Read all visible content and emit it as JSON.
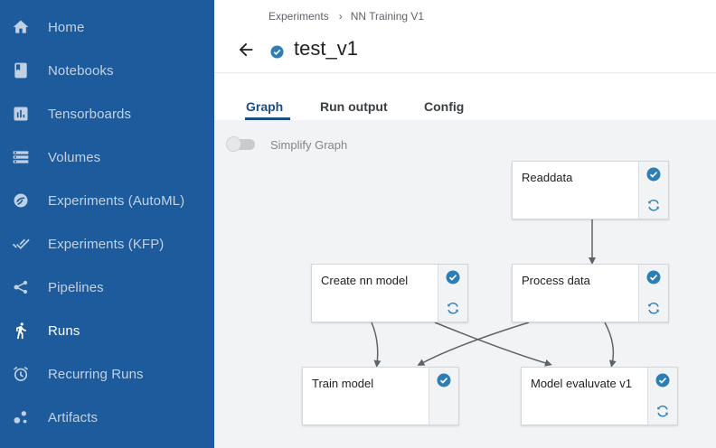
{
  "sidebar": {
    "items": [
      {
        "label": "Home",
        "icon": "home-icon"
      },
      {
        "label": "Notebooks",
        "icon": "notebook-icon"
      },
      {
        "label": "Tensorboards",
        "icon": "tensorboard-icon"
      },
      {
        "label": "Volumes",
        "icon": "volumes-icon"
      },
      {
        "label": "Experiments (AutoML)",
        "icon": "automl-icon"
      },
      {
        "label": "Experiments (KFP)",
        "icon": "double-check-icon"
      },
      {
        "label": "Pipelines",
        "icon": "pipeline-icon"
      },
      {
        "label": "Runs",
        "icon": "runner-icon"
      },
      {
        "label": "Recurring Runs",
        "icon": "alarm-icon"
      },
      {
        "label": "Artifacts",
        "icon": "artifacts-icon"
      }
    ],
    "active": "Runs"
  },
  "breadcrumb": {
    "items": [
      "Experiments",
      "NN Training V1"
    ],
    "separator": "›"
  },
  "header": {
    "title": "test_v1",
    "status": "succeeded"
  },
  "tabs": [
    {
      "label": "Graph",
      "active": true
    },
    {
      "label": "Run output",
      "active": false
    },
    {
      "label": "Config",
      "active": false
    }
  ],
  "graph": {
    "simplify_label": "Simplify Graph",
    "simplify_enabled": false,
    "nodes": [
      {
        "id": "readdata",
        "label": "Readdata",
        "status": "succeeded"
      },
      {
        "id": "create-nn-model",
        "label": "Create nn model",
        "status": "succeeded"
      },
      {
        "id": "process-data",
        "label": "Process data",
        "status": "succeeded"
      },
      {
        "id": "train-model",
        "label": "Train model",
        "status": "succeeded"
      },
      {
        "id": "model-evaluate",
        "label": "Model evaluvate v1",
        "status": "succeeded"
      }
    ],
    "edges": [
      [
        "readdata",
        "process-data"
      ],
      [
        "create-nn-model",
        "train-model"
      ],
      [
        "create-nn-model",
        "model-evaluate"
      ],
      [
        "process-data",
        "train-model"
      ],
      [
        "process-data",
        "model-evaluate"
      ]
    ]
  },
  "colors": {
    "sidebar_bg": "#1d5b9c",
    "accent": "#1c4e86",
    "success": "#2e7eb3",
    "canvas_bg": "#f1f3f4"
  }
}
